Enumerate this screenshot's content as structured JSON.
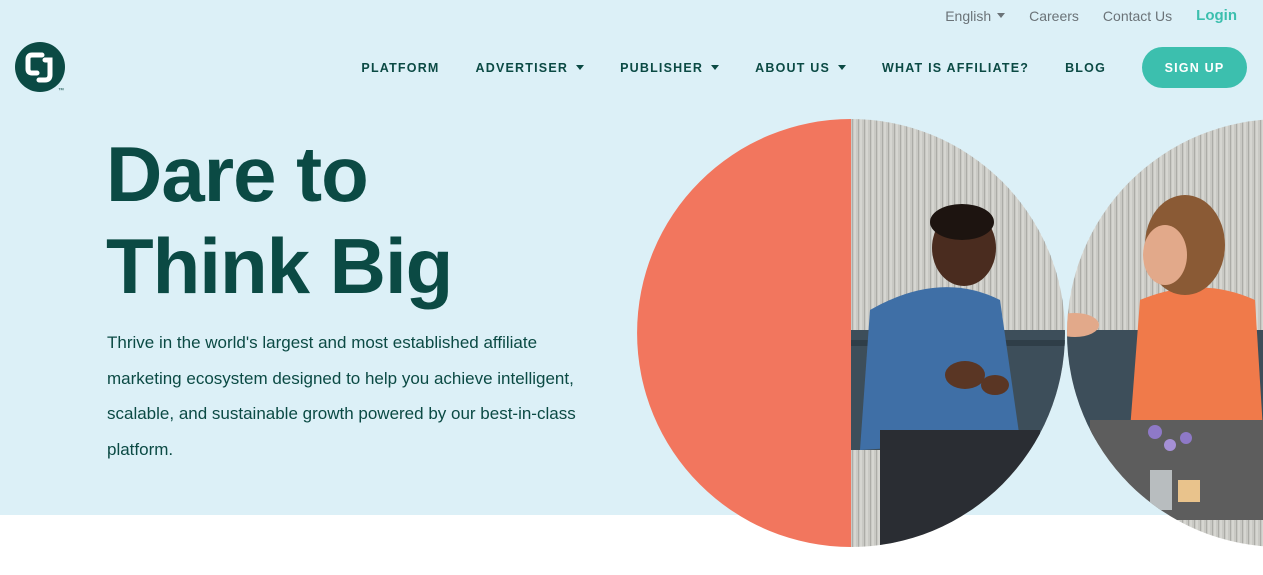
{
  "utility_nav": {
    "language": "English",
    "careers": "Careers",
    "contact": "Contact Us",
    "login": "Login"
  },
  "logo": {
    "icon": "cj-logo-icon",
    "trademark": "™"
  },
  "main_nav": {
    "items": [
      {
        "label": "PLATFORM",
        "dropdown": false
      },
      {
        "label": "ADVERTISER",
        "dropdown": true
      },
      {
        "label": "PUBLISHER",
        "dropdown": true
      },
      {
        "label": "ABOUT US",
        "dropdown": true
      },
      {
        "label": "WHAT IS AFFILIATE?",
        "dropdown": false
      },
      {
        "label": "BLOG",
        "dropdown": false
      }
    ],
    "signup": "SIGN UP"
  },
  "hero": {
    "headline_line1": "Dare to",
    "headline_line2": "Think Big",
    "description": "Thrive in the world's largest and most established affiliate marketing ecosystem designed to help you achieve intelligent, scalable, and sustainable growth powered by our best-in-class platform."
  },
  "colors": {
    "hero_bg": "#dcf0f7",
    "brand_dark": "#0b4a44",
    "accent_teal": "#3cbfae",
    "coral": "#f2765e"
  }
}
